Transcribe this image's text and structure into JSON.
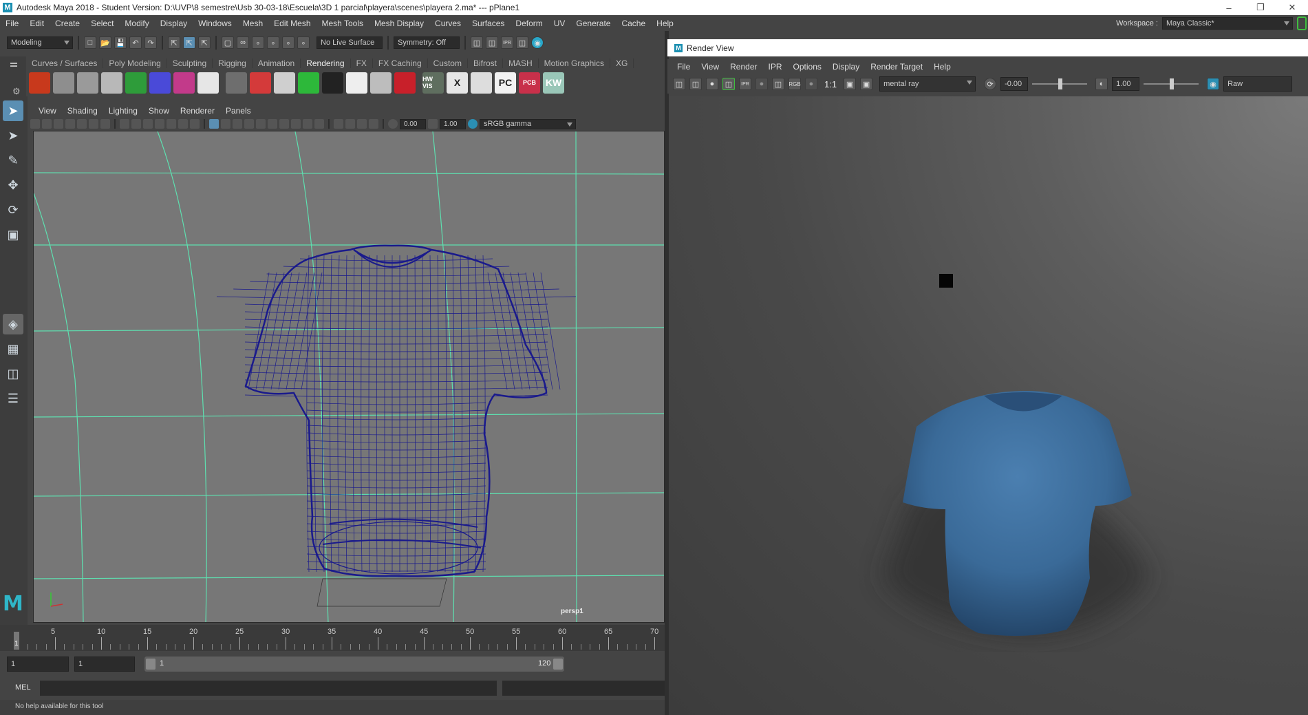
{
  "titlebar": {
    "title": "Autodesk Maya 2018 - Student Version: D:\\UVP\\8 semestre\\Usb 30-03-18\\Escuela\\3D 1 parcial\\playera\\scenes\\playera 2.ma*   ---   pPlane1",
    "logo": "M"
  },
  "menubar": {
    "items": [
      "File",
      "Edit",
      "Create",
      "Select",
      "Modify",
      "Display",
      "Windows",
      "Mesh",
      "Edit Mesh",
      "Mesh Tools",
      "Mesh Display",
      "Curves",
      "Surfaces",
      "Deform",
      "UV",
      "Generate",
      "Cache",
      "Help"
    ],
    "workspace_label": "Workspace :",
    "workspace_value": "Maya Classic*"
  },
  "statusline": {
    "mode": "Modeling",
    "live_surface": "No Live Surface",
    "symmetry": "Symmetry: Off"
  },
  "shelf": {
    "tabs": [
      "Curves / Surfaces",
      "Poly Modeling",
      "Sculpting",
      "Rigging",
      "Animation",
      "Rendering",
      "FX",
      "FX Caching",
      "Custom",
      "Bifrost",
      "MASH",
      "Motion Graphics",
      "XG"
    ],
    "icons": [
      {
        "name": "flame-icon",
        "color": "#c8391c",
        "label": ""
      },
      {
        "name": "create-camera-icon",
        "color": "#8e8e8e",
        "label": ""
      },
      {
        "name": "sphere-icon",
        "color": "#9a9a9a",
        "label": ""
      },
      {
        "name": "shiny-sphere-icon",
        "color": "#b8b8b8",
        "label": ""
      },
      {
        "name": "green-material-icon",
        "color": "#2e9c3a",
        "label": ""
      },
      {
        "name": "blue-volume-icon",
        "color": "#4a4ad8",
        "label": ""
      },
      {
        "name": "particles-icon",
        "color": "#c23a8a",
        "label": ""
      },
      {
        "name": "dots-icon",
        "color": "#e6e6e6",
        "label": ""
      },
      {
        "name": "gray-sphere-icon",
        "color": "#6e6e6e",
        "label": ""
      },
      {
        "name": "red-light-icon",
        "color": "#d43a3a",
        "label": ""
      },
      {
        "name": "area-light-icon",
        "color": "#cfcfcf",
        "label": ""
      },
      {
        "name": "green-light-icon",
        "color": "#2db83a",
        "label": ""
      },
      {
        "name": "dark-shape-icon",
        "color": "#222222",
        "label": ""
      },
      {
        "name": "white-blob-icon",
        "color": "#eeeeee",
        "label": ""
      },
      {
        "name": "disk-icon",
        "color": "#bdbdbd",
        "label": ""
      },
      {
        "name": "red-eye-icon",
        "color": "#c8202a",
        "label": ""
      },
      {
        "name": "hw-vis-icon",
        "color": "#5f6e5f",
        "label": "HW VIS"
      },
      {
        "name": "no-render-icon",
        "color": "#e6e6e6",
        "label": "X"
      },
      {
        "name": "gradient-bars-icon",
        "color": "#dddddd",
        "label": ""
      },
      {
        "name": "pc-icon",
        "color": "#f2f2f2",
        "label": "PC"
      },
      {
        "name": "pcb-icon",
        "color": "#c8304a",
        "label": "PCB"
      },
      {
        "name": "kw-search-icon",
        "color": "#9ac7b8",
        "label": "KW"
      }
    ]
  },
  "panel": {
    "menus": [
      "View",
      "Shading",
      "Lighting",
      "Show",
      "Renderer",
      "Panels"
    ],
    "exposure": "0.00",
    "gamma": "1.00",
    "color_space": "sRGB gamma",
    "camera_label": "persp1"
  },
  "timeline": {
    "ticks": [
      "5",
      "10",
      "15",
      "20",
      "25",
      "30",
      "35",
      "40",
      "45",
      "50",
      "55",
      "60",
      "65",
      "70"
    ],
    "current_frame": "1"
  },
  "range": {
    "start": "1",
    "anim_start": "1",
    "slider_start": "1",
    "slider_end": "120"
  },
  "cmdline": {
    "lang": "MEL",
    "help": "No help available for this tool"
  },
  "renderview": {
    "title": "Render View",
    "menus": [
      "File",
      "View",
      "Render",
      "IPR",
      "Options",
      "Display",
      "Render Target",
      "Help"
    ],
    "ratio": "1:1",
    "renderer": "mental ray",
    "exposure": "-0.00",
    "gamma": "1.00",
    "view_transform": "Raw"
  },
  "colors": {
    "accent": "#5bb4e0",
    "wireframe": "#1a1a8c",
    "grid": "#5ee0b0",
    "shirt": "#3e6e9c"
  }
}
